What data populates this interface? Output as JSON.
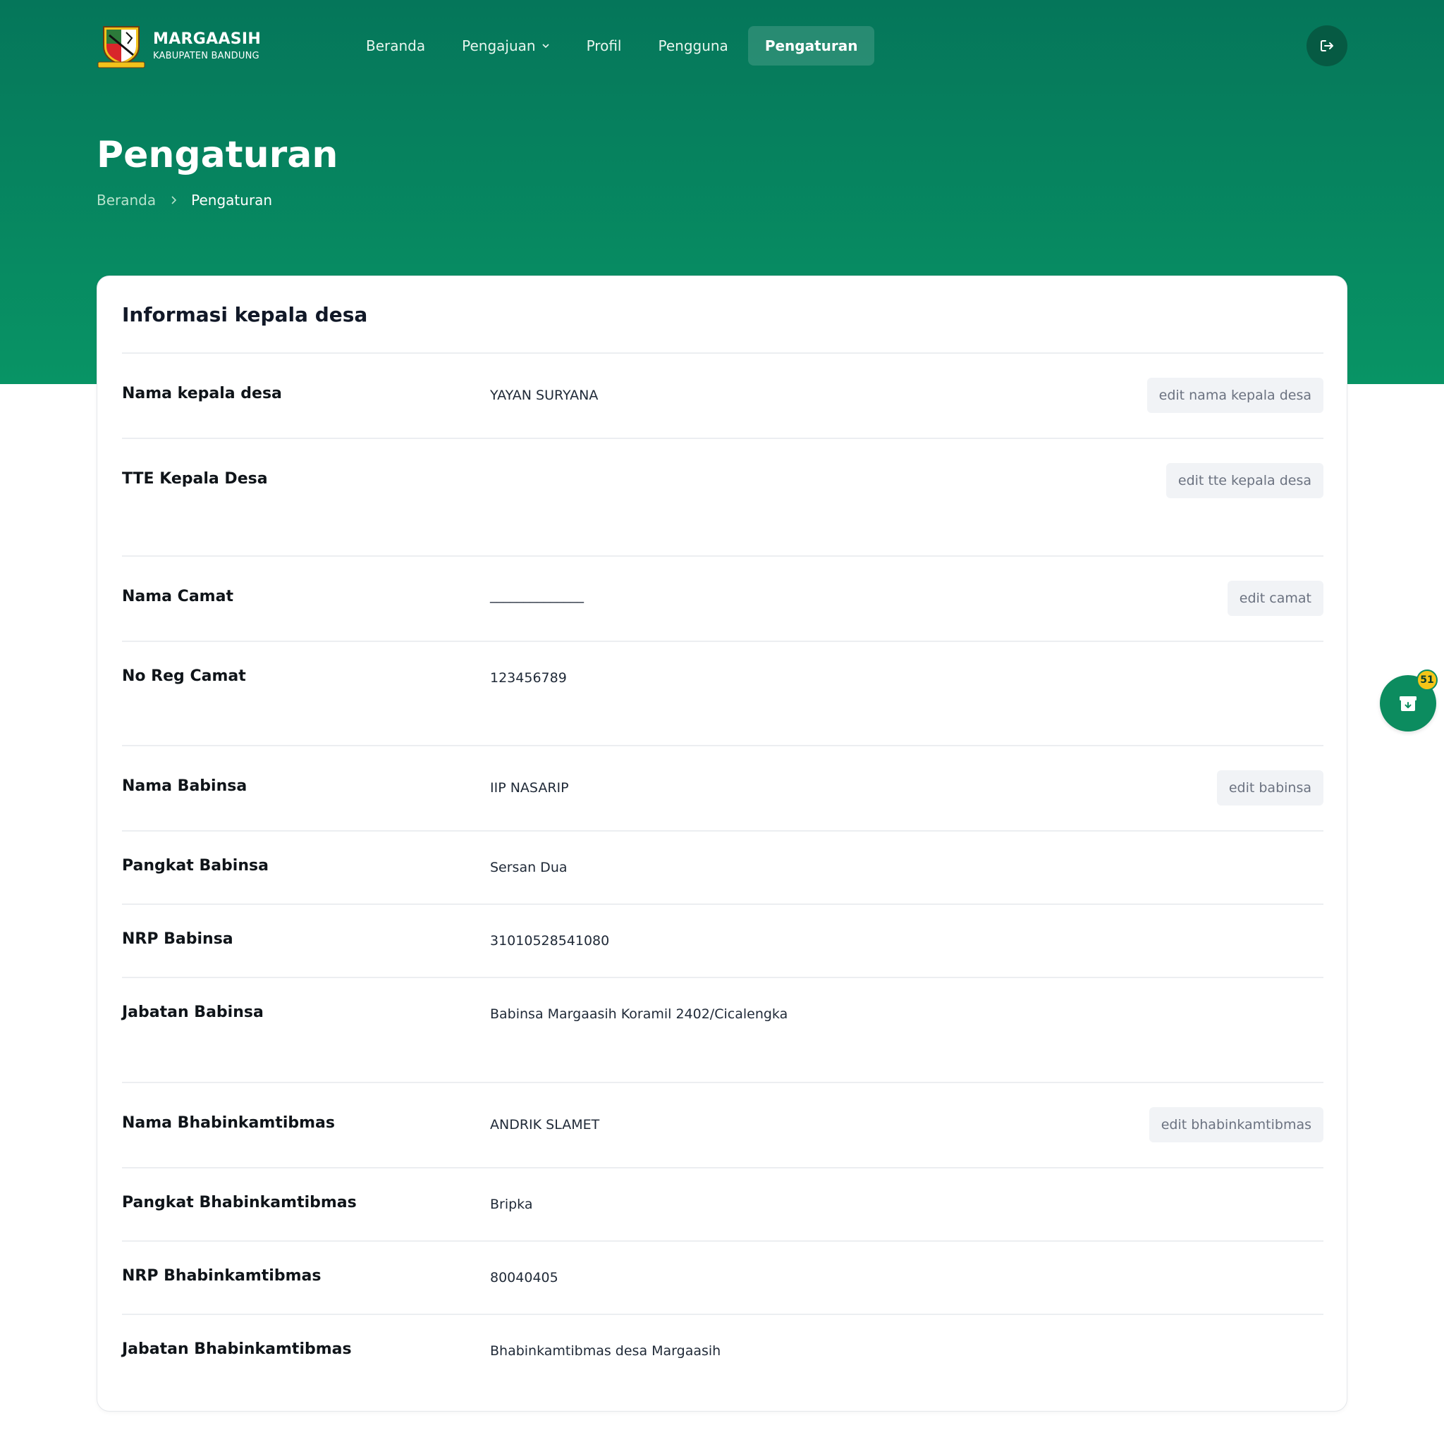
{
  "brand": {
    "name": "MARGAASIH",
    "subtitle": "KABUPATEN BANDUNG"
  },
  "nav": {
    "items": [
      {
        "label": "Beranda"
      },
      {
        "label": "Pengajuan"
      },
      {
        "label": "Profil"
      },
      {
        "label": "Pengguna"
      },
      {
        "label": "Pengaturan"
      }
    ],
    "active": "Pengaturan"
  },
  "header": {
    "title": "Pengaturan",
    "breadcrumb": {
      "home": "Beranda",
      "current": "Pengaturan"
    }
  },
  "card": {
    "title": "Informasi kepala desa",
    "rows": [
      {
        "label": "Nama kepala desa",
        "value": "YAYAN SURYANA",
        "action": "edit nama kepala desa"
      },
      {
        "label": "TTE Kepala Desa",
        "value": "",
        "action": "edit tte kepala desa"
      },
      {
        "label": "Nama Camat",
        "value": "______________",
        "action": "edit camat"
      },
      {
        "label": "No Reg Camat",
        "value": "123456789",
        "action": ""
      },
      {
        "label": "Nama Babinsa",
        "value": "IIP NASARIP",
        "action": "edit babinsa"
      },
      {
        "label": "Pangkat Babinsa",
        "value": "Sersan Dua",
        "action": ""
      },
      {
        "label": "NRP Babinsa",
        "value": "31010528541080",
        "action": ""
      },
      {
        "label": "Jabatan Babinsa",
        "value": "Babinsa Margaasih Koramil 2402/Cicalengka",
        "action": ""
      },
      {
        "label": "Nama Bhabinkamtibmas",
        "value": "ANDRIK SLAMET",
        "action": "edit bhabinkamtibmas"
      },
      {
        "label": "Pangkat Bhabinkamtibmas",
        "value": "Bripka",
        "action": ""
      },
      {
        "label": "NRP Bhabinkamtibmas",
        "value": "80040405",
        "action": ""
      },
      {
        "label": "Jabatan Bhabinkamtibmas",
        "value": "Bhabinkamtibmas desa Margaasih",
        "action": ""
      }
    ]
  },
  "fab": {
    "badge_count": "51",
    "icon": "archive-download-icon"
  },
  "colors": {
    "primary": "#089465",
    "primary_dark": "#05765a",
    "badge": "#f5c518"
  }
}
